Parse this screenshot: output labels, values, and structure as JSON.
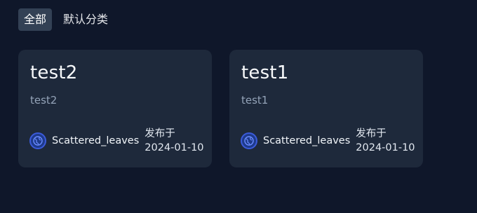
{
  "tabs": [
    {
      "label": "全部",
      "active": true
    },
    {
      "label": "默认分类",
      "active": false
    }
  ],
  "cards": [
    {
      "title": "test2",
      "description": "test2",
      "author": "Scattered_leaves",
      "published_label": "发布于",
      "published_date": "2024-01-10"
    },
    {
      "title": "test1",
      "description": "test1",
      "author": "Scattered_leaves",
      "published_label": "发布于",
      "published_date": "2024-01-10"
    }
  ],
  "colors": {
    "background": "#0f172a",
    "card": "#1e293b",
    "active_tab": "#334155",
    "accent": "#3b5bdb"
  }
}
